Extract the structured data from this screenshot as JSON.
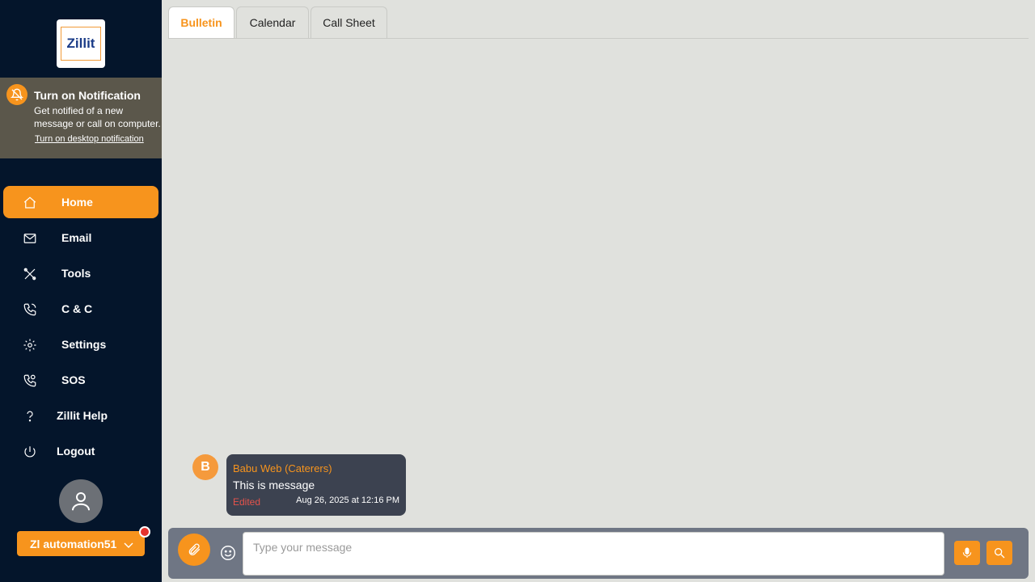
{
  "sidebar": {
    "logo_text": "Zillit",
    "notification": {
      "title": "Turn on Notification",
      "text": "Get notified of a new message or call on computer.",
      "link": "Turn on desktop notification"
    },
    "items": [
      {
        "label": "Home",
        "icon": "home-icon",
        "active": true
      },
      {
        "label": "Email",
        "icon": "mail-icon"
      },
      {
        "label": "Tools",
        "icon": "tools-icon"
      },
      {
        "label": "C & C",
        "icon": "phone-icon"
      },
      {
        "label": "Settings",
        "icon": "gear-icon"
      },
      {
        "label": "SOS",
        "icon": "sos-phone-icon"
      },
      {
        "label": "Zillit Help",
        "icon": "help-icon"
      },
      {
        "label": "Logout",
        "icon": "power-icon"
      }
    ],
    "user": {
      "name": "Zl automation51"
    }
  },
  "tabs": [
    {
      "label": "Bulletin",
      "active": true
    },
    {
      "label": "Calendar"
    },
    {
      "label": "Call Sheet"
    }
  ],
  "message": {
    "avatar_letter": "B",
    "sender": "Babu Web (Caterers)",
    "text": "This is message",
    "edited": "Edited",
    "time": "Aug 26, 2025 at 12:16 PM"
  },
  "composer": {
    "placeholder": "Type your message"
  },
  "colors": {
    "accent": "#f7941d",
    "sidebar_bg": "#04152b",
    "content_bg": "#e0e1dd",
    "bubble_bg": "#3c4250"
  }
}
